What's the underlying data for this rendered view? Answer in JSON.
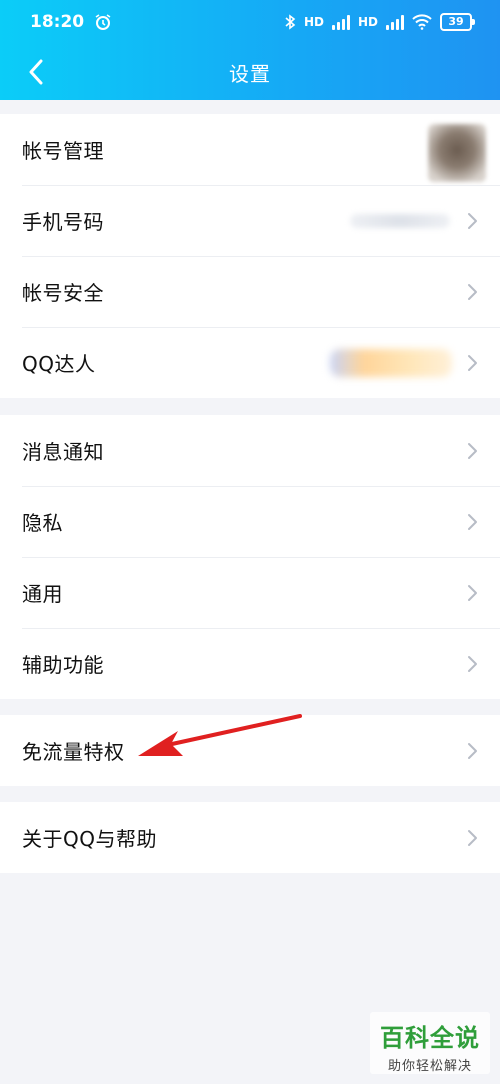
{
  "status_bar": {
    "time": "18:20",
    "battery": "39",
    "network_1": "HD",
    "network_2": "HD"
  },
  "header": {
    "title": "设置"
  },
  "groups": [
    {
      "items": [
        {
          "label": "帐号管理"
        },
        {
          "label": "手机号码"
        },
        {
          "label": "帐号安全"
        },
        {
          "label": "QQ达人"
        }
      ]
    },
    {
      "items": [
        {
          "label": "消息通知"
        },
        {
          "label": "隐私"
        },
        {
          "label": "通用"
        },
        {
          "label": "辅助功能"
        }
      ]
    },
    {
      "items": [
        {
          "label": "免流量特权"
        }
      ]
    },
    {
      "items": [
        {
          "label": "关于QQ与帮助"
        }
      ]
    }
  ],
  "watermark": {
    "main": "百科全说",
    "sub": "助你轻松解决"
  },
  "colors": {
    "header_start": "#0bcdf8",
    "header_end": "#1f93f2",
    "background": "#f3f4f8",
    "annotation_arrow": "#e02020"
  }
}
